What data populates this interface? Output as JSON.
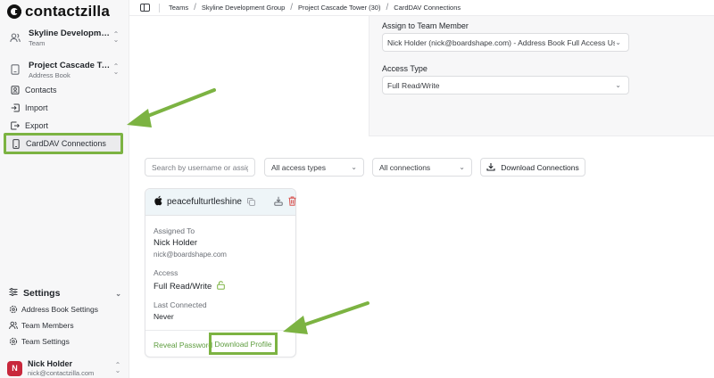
{
  "app": {
    "logo_text": "contactzilla"
  },
  "sidebar": {
    "team_switcher": {
      "title": "Skyline Developmen...",
      "subtitle": "Team"
    },
    "book_switcher": {
      "title": "Project Cascade Tow...",
      "subtitle": "Address Book"
    },
    "nav": [
      {
        "label": "Contacts",
        "icon": "contacts-icon"
      },
      {
        "label": "Import",
        "icon": "import-icon"
      },
      {
        "label": "Export",
        "icon": "export-icon"
      },
      {
        "label": "CardDAV Connections",
        "icon": "device-icon",
        "active": true
      }
    ],
    "settings": {
      "label": "Settings",
      "items": [
        {
          "label": "Address Book Settings",
          "icon": "gear-icon"
        },
        {
          "label": "Team Members",
          "icon": "users-icon"
        },
        {
          "label": "Team Settings",
          "icon": "gear-icon"
        }
      ]
    },
    "user": {
      "initial": "N",
      "name": "Nick Holder",
      "email": "nick@contactzilla.com"
    }
  },
  "breadcrumb": [
    "Teams",
    "Skyline Development Group",
    "Project Cascade Tower (30)",
    "CardDAV Connections"
  ],
  "form": {
    "assign_label": "Assign to Team Member",
    "assign_value": "Nick Holder (nick@boardshape.com) - Address Book Full Access User",
    "access_label": "Access Type",
    "access_value": "Full Read/Write"
  },
  "filters": {
    "search_placeholder": "Search by username or assignee",
    "access_types": "All access types",
    "connections": "All connections",
    "download_label": "Download Connections"
  },
  "card": {
    "username": "peacefulturtleshine",
    "assigned_label": "Assigned To",
    "assigned_name": "Nick Holder",
    "assigned_email": "nick@boardshape.com",
    "access_label": "Access",
    "access_value": "Full Read/Write",
    "last_label": "Last Connected",
    "last_value": "Never",
    "reveal_label": "Reveal Password",
    "download_label": "Download Profile"
  },
  "colors": {
    "accent_green": "#7cb342",
    "link_green": "#5e9d3f",
    "danger": "#d9534f",
    "avatar": "#c8283c"
  }
}
